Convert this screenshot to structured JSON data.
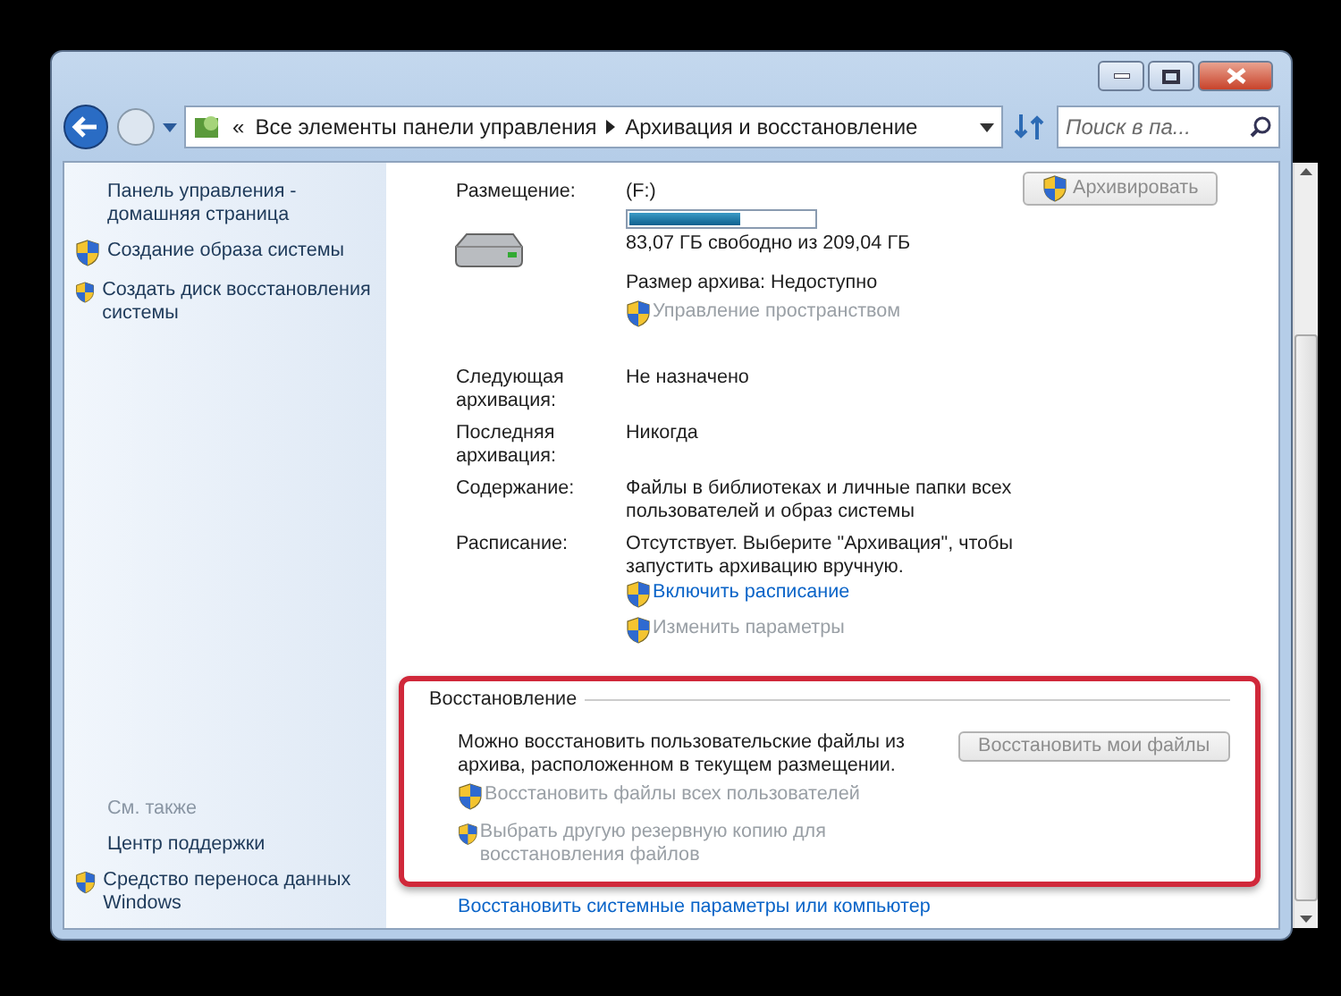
{
  "address_bar": {
    "overflow": "«",
    "breadcrumbs": [
      "Все элементы панели управления",
      "Архивация и восстановление"
    ],
    "search_placeholder": "Поиск в па..."
  },
  "sidebar": {
    "items": [
      {
        "label": "Панель управления - домашняя страница",
        "shield": false
      },
      {
        "label": "Создание образа системы",
        "shield": true
      },
      {
        "label": "Создать диск восстановления системы",
        "shield": true
      }
    ],
    "see_also_title": "См. также",
    "see_also": [
      {
        "label": "Центр поддержки",
        "shield": false
      },
      {
        "label": "Средство переноса данных Windows",
        "shield": true
      }
    ]
  },
  "backup": {
    "location_label": "Размещение:",
    "drive": "(F:)",
    "level": 0.6,
    "free_text": "83,07 ГБ свободно из 209,04 ГБ",
    "archive_size": "Размер архива: Недоступно",
    "manage_link": {
      "label": "Управление пространством",
      "disabled": true
    },
    "button": {
      "label": "Архивировать",
      "disabled": true
    },
    "rows": [
      {
        "label": "Следующая архивация:",
        "value": "Не назначено"
      },
      {
        "label": "Последняя архивация:",
        "value": "Никогда"
      },
      {
        "label": "Содержание:",
        "value": "Файлы в библиотеках и личные папки всех пользователей и образ системы"
      },
      {
        "label": "Расписание:",
        "value": "Отсутствует. Выберите \"Архивация\", чтобы запустить архивацию вручную."
      }
    ],
    "schedule_links": [
      {
        "label": "Включить расписание",
        "disabled": false
      },
      {
        "label": "Изменить параметры",
        "disabled": true
      }
    ]
  },
  "restore": {
    "title": "Восстановление",
    "highlighted": true,
    "text": "Можно восстановить пользовательские файлы из архива, расположенном в текущем размещении.",
    "button": {
      "label": "Восстановить мои файлы",
      "disabled": true
    },
    "links": [
      {
        "label": "Восстановить файлы всех пользователей",
        "disabled": true
      },
      {
        "label": "Выбрать другую резервную копию для восстановления файлов",
        "disabled": true
      }
    ]
  },
  "system_restore_link": "Восстановить системные параметры или компьютер"
}
